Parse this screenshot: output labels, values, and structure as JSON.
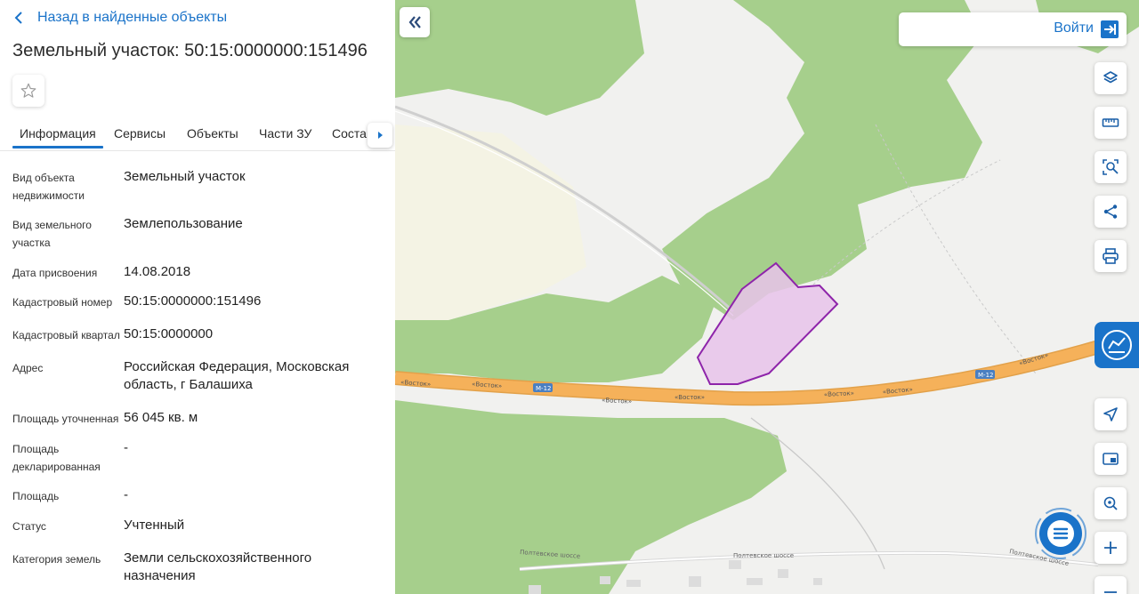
{
  "back_link": {
    "label": "Назад в найденные объекты"
  },
  "title": "Земельный участок: 50:15:0000000:151496",
  "tabs": [
    {
      "label": "Информация",
      "active": true
    },
    {
      "label": "Сервисы"
    },
    {
      "label": "Объекты"
    },
    {
      "label": "Части ЗУ"
    },
    {
      "label": "Состав"
    }
  ],
  "info": [
    {
      "label": "Вид объекта недвижимости",
      "value": "Земельный участок"
    },
    {
      "label": "Вид земельного участка",
      "value": "Землепользование"
    },
    {
      "label": "Дата присвоения",
      "value": "14.08.2018"
    },
    {
      "label": "Кадастровый номер",
      "value": "50:15:0000000:151496"
    },
    {
      "label": "Кадастровый квартал",
      "value": "50:15:0000000"
    },
    {
      "label": "Адрес",
      "value": "Российская Федерация, Московская область, г Балашиха"
    },
    {
      "label": "Площадь уточненная",
      "value": "56 045 кв. м"
    },
    {
      "label": "Площадь декларированная",
      "value": "-"
    },
    {
      "label": "Площадь",
      "value": "-"
    },
    {
      "label": "Статус",
      "value": "Учтенный"
    },
    {
      "label": "Категория земель",
      "value": "Земли сельскохозяйственного назначения"
    }
  ],
  "map": {
    "login_label": "Войти",
    "road_labels": {
      "vostok": "«Восток»",
      "m12": "М-12",
      "poltevskoe": "Полтевское шоссе"
    },
    "tools": [
      "layers-icon",
      "ruler-icon",
      "area-search-icon",
      "share-icon",
      "print-icon",
      "locate-icon",
      "minimap-icon",
      "geo-search-icon",
      "zoom-in-icon",
      "zoom-out-icon"
    ]
  },
  "colors": {
    "accent": "#1a73c9",
    "forest": "#a6cf8c",
    "road": "#f5b15a",
    "parcel_fill": "#e7c3ea",
    "parcel_stroke": "#8e24aa"
  }
}
